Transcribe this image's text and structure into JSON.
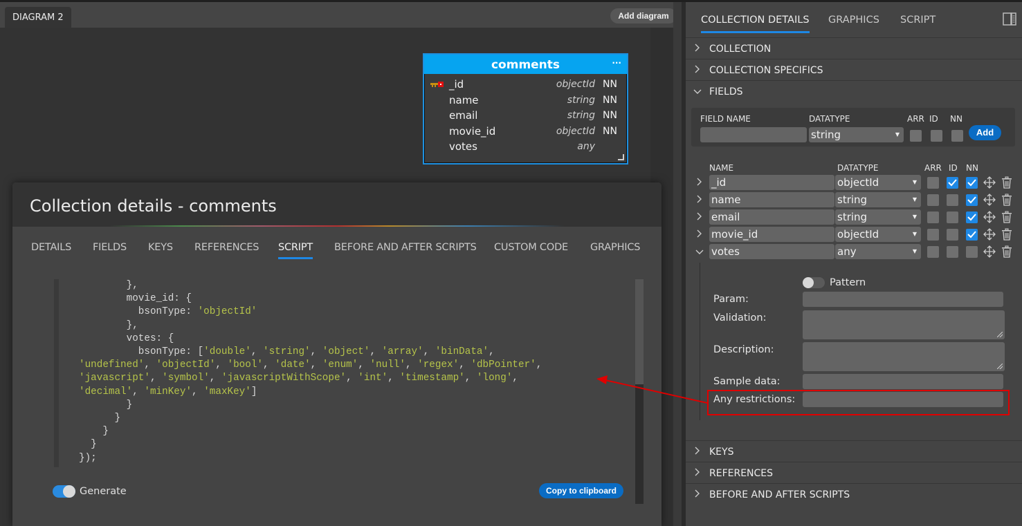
{
  "diagram": {
    "tab_label": "DIAGRAM 2",
    "add_diagram_label": "Add diagram"
  },
  "entity": {
    "name": "comments",
    "more_label": "···",
    "fields": [
      {
        "name": "_id",
        "type": "objectId",
        "nn": "NN",
        "pk": true
      },
      {
        "name": "name",
        "type": "string",
        "nn": "NN",
        "pk": false
      },
      {
        "name": "email",
        "type": "string",
        "nn": "NN",
        "pk": false
      },
      {
        "name": "movie_id",
        "type": "objectId",
        "nn": "NN",
        "pk": false
      },
      {
        "name": "votes",
        "type": "any",
        "nn": "",
        "pk": false
      }
    ]
  },
  "modal": {
    "title": "Collection details - comments",
    "tabs": [
      "DETAILS",
      "FIELDS",
      "KEYS",
      "REFERENCES",
      "SCRIPT",
      "BEFORE AND AFTER SCRIPTS",
      "CUSTOM CODE",
      "GRAPHICS"
    ],
    "active_tab": "SCRIPT",
    "script_lines": [
      [
        {
          "t": "        },",
          "c": "p"
        }
      ],
      [
        {
          "t": "        movie_id: {",
          "c": "p"
        }
      ],
      [
        {
          "t": "          bsonType: ",
          "c": "p"
        },
        {
          "t": "'objectId'",
          "c": "s"
        }
      ],
      [
        {
          "t": "        },",
          "c": "p"
        }
      ],
      [
        {
          "t": "        votes: {",
          "c": "p"
        }
      ],
      [
        {
          "t": "          bsonType: [",
          "c": "p"
        },
        {
          "t": "'double'",
          "c": "s"
        },
        {
          "t": ", ",
          "c": "p"
        },
        {
          "t": "'string'",
          "c": "s"
        },
        {
          "t": ", ",
          "c": "p"
        },
        {
          "t": "'object'",
          "c": "s"
        },
        {
          "t": ", ",
          "c": "p"
        },
        {
          "t": "'array'",
          "c": "s"
        },
        {
          "t": ", ",
          "c": "p"
        },
        {
          "t": "'binData'",
          "c": "s"
        },
        {
          "t": ",",
          "c": "p"
        }
      ],
      [
        {
          "t": "'undefined'",
          "c": "s"
        },
        {
          "t": ", ",
          "c": "p"
        },
        {
          "t": "'objectId'",
          "c": "s"
        },
        {
          "t": ", ",
          "c": "p"
        },
        {
          "t": "'bool'",
          "c": "s"
        },
        {
          "t": ", ",
          "c": "p"
        },
        {
          "t": "'date'",
          "c": "s"
        },
        {
          "t": ", ",
          "c": "p"
        },
        {
          "t": "'enum'",
          "c": "s"
        },
        {
          "t": ", ",
          "c": "p"
        },
        {
          "t": "'null'",
          "c": "s"
        },
        {
          "t": ", ",
          "c": "p"
        },
        {
          "t": "'regex'",
          "c": "s"
        },
        {
          "t": ", ",
          "c": "p"
        },
        {
          "t": "'dbPointer'",
          "c": "s"
        },
        {
          "t": ",",
          "c": "p"
        }
      ],
      [
        {
          "t": "'javascript'",
          "c": "s"
        },
        {
          "t": ", ",
          "c": "p"
        },
        {
          "t": "'symbol'",
          "c": "s"
        },
        {
          "t": ", ",
          "c": "p"
        },
        {
          "t": "'javascriptWithScope'",
          "c": "s"
        },
        {
          "t": ", ",
          "c": "p"
        },
        {
          "t": "'int'",
          "c": "s"
        },
        {
          "t": ", ",
          "c": "p"
        },
        {
          "t": "'timestamp'",
          "c": "s"
        },
        {
          "t": ", ",
          "c": "p"
        },
        {
          "t": "'long'",
          "c": "s"
        },
        {
          "t": ",",
          "c": "p"
        }
      ],
      [
        {
          "t": "'decimal'",
          "c": "s"
        },
        {
          "t": ", ",
          "c": "p"
        },
        {
          "t": "'minKey'",
          "c": "s"
        },
        {
          "t": ", ",
          "c": "p"
        },
        {
          "t": "'maxKey'",
          "c": "s"
        },
        {
          "t": "]",
          "c": "p"
        }
      ],
      [
        {
          "t": "        }",
          "c": "p"
        }
      ],
      [
        {
          "t": "      }",
          "c": "p"
        }
      ],
      [
        {
          "t": "    }",
          "c": "p"
        }
      ],
      [
        {
          "t": "  }",
          "c": "p"
        }
      ],
      [
        {
          "t": "});",
          "c": "p"
        }
      ]
    ],
    "generate_label": "Generate",
    "generate_on": true,
    "copy_label": "Copy to clipboard"
  },
  "panel": {
    "tabs": [
      "COLLECTION DETAILS",
      "GRAPHICS",
      "SCRIPT"
    ],
    "active_tab": "COLLECTION DETAILS",
    "sections_top": [
      {
        "label": "COLLECTION",
        "expanded": false
      },
      {
        "label": "COLLECTION SPECIFICS",
        "expanded": false
      },
      {
        "label": "FIELDS",
        "expanded": true
      }
    ],
    "new_field": {
      "name_label": "FIELD NAME",
      "name_value": "",
      "datatype_label": "DATATYPE",
      "datatype_value": "string",
      "arr_label": "ARR",
      "id_label": "ID",
      "nn_label": "NN",
      "add_label": "Add"
    },
    "fields_header": {
      "name": "NAME",
      "datatype": "DATATYPE",
      "arr": "ARR",
      "id": "ID",
      "nn": "NN"
    },
    "fields": [
      {
        "name": "_id",
        "datatype": "objectId",
        "arr": false,
        "id": true,
        "nn": true,
        "expanded": false
      },
      {
        "name": "name",
        "datatype": "string",
        "arr": false,
        "id": false,
        "nn": true,
        "expanded": false
      },
      {
        "name": "email",
        "datatype": "string",
        "arr": false,
        "id": false,
        "nn": true,
        "expanded": false
      },
      {
        "name": "movie_id",
        "datatype": "objectId",
        "arr": false,
        "id": false,
        "nn": true,
        "expanded": false
      },
      {
        "name": "votes",
        "datatype": "any",
        "arr": false,
        "id": false,
        "nn": false,
        "expanded": true
      }
    ],
    "field_details": {
      "pattern_label": "Pattern",
      "pattern_on": false,
      "param_label": "Param:",
      "param_value": "",
      "validation_label": "Validation:",
      "validation_value": "",
      "description_label": "Description:",
      "description_value": "",
      "sample_label": "Sample data:",
      "sample_value": "",
      "restrictions_label": "Any restrictions:",
      "restrictions_value": ""
    },
    "sections_bottom": [
      {
        "label": "KEYS",
        "expanded": false
      },
      {
        "label": "REFERENCES",
        "expanded": false
      },
      {
        "label": "BEFORE AND AFTER SCRIPTS",
        "expanded": false
      }
    ]
  },
  "annotation": {
    "color": "#e00000"
  },
  "colors": {
    "accent": "#1e88e5",
    "button": "#0a6cc4",
    "entity_header": "#06a4f0",
    "code_string": "#b6c44a"
  }
}
